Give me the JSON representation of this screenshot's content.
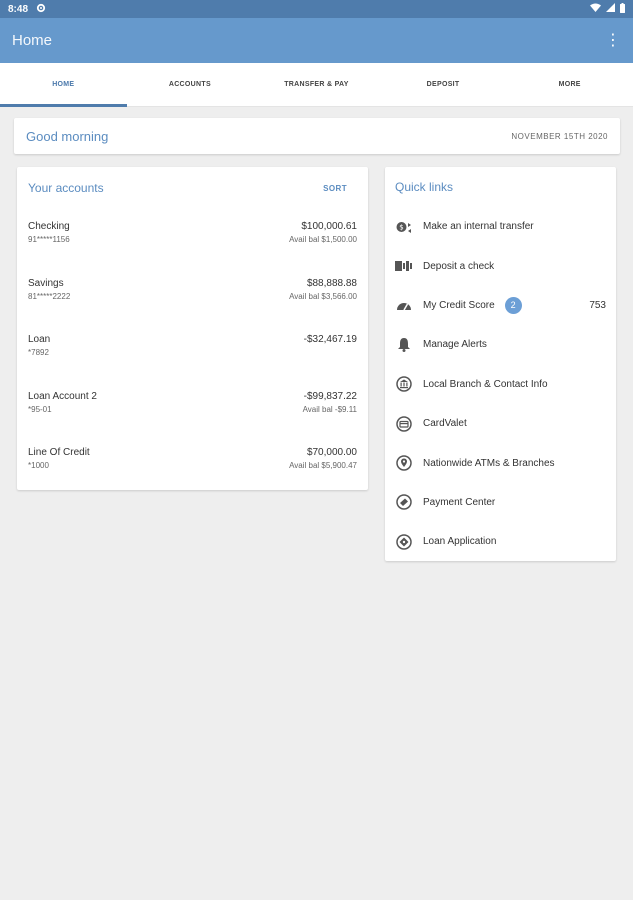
{
  "status_bar": {
    "time": "8:48"
  },
  "app_bar": {
    "title": "Home",
    "menu_glyph": "⋮"
  },
  "tabs": [
    {
      "label": "HOME",
      "active": true
    },
    {
      "label": "ACCOUNTS",
      "active": false
    },
    {
      "label": "TRANSFER & PAY",
      "active": false
    },
    {
      "label": "DEPOSIT",
      "active": false
    },
    {
      "label": "MORE",
      "active": false
    }
  ],
  "greeting": {
    "text": "Good morning",
    "date": "NOVEMBER 15TH 2020"
  },
  "accounts": {
    "title": "Your accounts",
    "sort_label": "SORT",
    "items": [
      {
        "name": "Checking",
        "number": "91*****1156",
        "amount": "$100,000.61",
        "avail": "Avail bal $1,500.00"
      },
      {
        "name": "Savings",
        "number": "81*****2222",
        "amount": "$88,888.88",
        "avail": "Avail bal $3,566.00"
      },
      {
        "name": "Loan",
        "number": "*7892",
        "amount": "-$32,467.19",
        "avail": ""
      },
      {
        "name": "Loan Account 2",
        "number": "*95-01",
        "amount": "-$99,837.22",
        "avail": "Avail bal -$9.11"
      },
      {
        "name": "Line Of Credit",
        "number": "*1000",
        "amount": "$70,000.00",
        "avail": "Avail bal $5,900.47"
      }
    ]
  },
  "quick_links": {
    "title": "Quick links",
    "items": [
      {
        "label": "Make an internal transfer",
        "icon": "transfer-icon"
      },
      {
        "label": "Deposit a check",
        "icon": "check-deposit-icon"
      },
      {
        "label": "My Credit Score",
        "icon": "gauge-icon",
        "badge": "2",
        "score": "753"
      },
      {
        "label": "Manage Alerts",
        "icon": "bell-icon"
      },
      {
        "label": "Local Branch & Contact Info",
        "icon": "bank-icon"
      },
      {
        "label": "CardValet",
        "icon": "card-icon"
      },
      {
        "label": "Nationwide ATMs & Branches",
        "icon": "location-pin-icon"
      },
      {
        "label": "Payment Center",
        "icon": "payment-icon"
      },
      {
        "label": "Loan Application",
        "icon": "loan-icon"
      }
    ]
  },
  "colors": {
    "status_bar": "#4f7cac",
    "app_bar": "#6699cc",
    "accent": "#5b8cc0",
    "badge": "#6c9fd6",
    "background": "#eeeeee"
  }
}
